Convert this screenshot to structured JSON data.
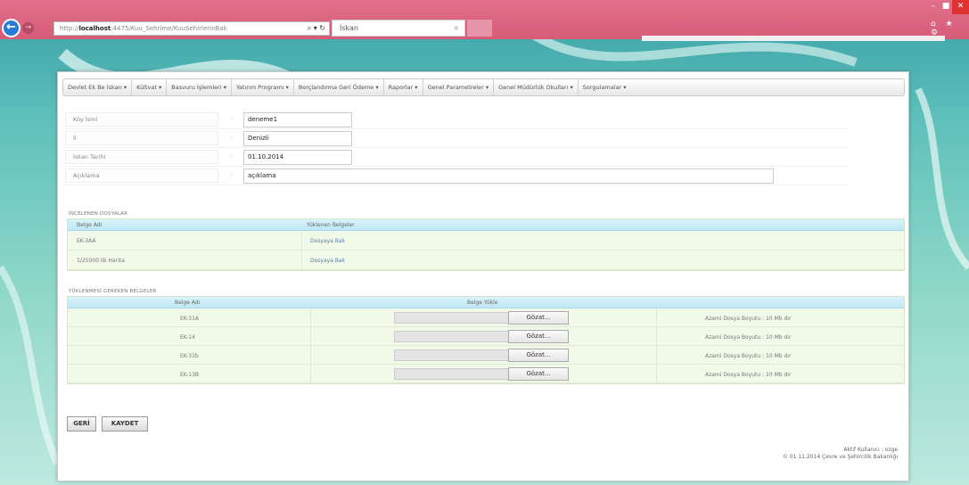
{
  "browser": {
    "url_prefix": "http://",
    "url_host": "localhost",
    "url_rest": ":4475/Kuu_Sehrime/KuuSehirlerinBak",
    "address_controls": "⌕ ▾ ↻",
    "tab_title": "İskan",
    "tab_close": "×",
    "win_min": "–",
    "win_max": "■",
    "win_close": "✕",
    "toolbar_icons": "⌂ ★ ⚙"
  },
  "menu": [
    "Devlet Ek Be İskan ▾",
    "Kültvat ▾",
    "Basvuru İşlemleri ▾",
    "Yatırım Programı ▾",
    "Borçlandırma Geri Ödeme ▾",
    "Raporlar ▾",
    "Genel Parametreler ▾",
    "Genel Müdürlük Okulları ▾",
    "Sorgulamalar ▾"
  ],
  "form": {
    "colon": ":",
    "fields": [
      {
        "label": "Köy İsmi",
        "value": "deneme1"
      },
      {
        "label": "İl",
        "value": "Denizli"
      },
      {
        "label": "İskan Tarihi",
        "value": "01.10.2014"
      },
      {
        "label": "Açıklama",
        "value": "açıklama"
      }
    ]
  },
  "reviewed_docs": {
    "section_title": "İNCELENEN DOSYALAR",
    "col_name": "Belge Adı",
    "col_uploaded": "Yüklenen Belgeler",
    "rows": [
      {
        "name": "EK-3AA",
        "link": "Dosyaya Bak"
      },
      {
        "name": "1/25000 lik Harita",
        "link": "Dosyaya Bak"
      }
    ]
  },
  "required_docs": {
    "section_title": "YÜKLENMESİ GEREKEN BELGELER",
    "col_name": "Belge Adı",
    "col_upload": "Belge Yükle",
    "browse_label": "Gözat...",
    "rows": [
      {
        "name": "EK-31A",
        "note": "Azami Dosya Boyutu : 10 Mb dır"
      },
      {
        "name": "EK-14",
        "note": "Azami Dosya Boyutu : 10 Mb dır"
      },
      {
        "name": "EK-31b",
        "note": "Azami Dosya Boyutu : 10 Mb dır"
      },
      {
        "name": "EK-13B",
        "note": "Azami Dosya Boyutu : 10 Mb dır"
      }
    ]
  },
  "buttons": {
    "back": "GERİ",
    "save": "KAYDET"
  },
  "footer": {
    "user_line": "Aktif Kullanıcı : ozge",
    "copyright": "© 01.11.2014 Çevre ve Şehircilik Bakanlığı"
  }
}
